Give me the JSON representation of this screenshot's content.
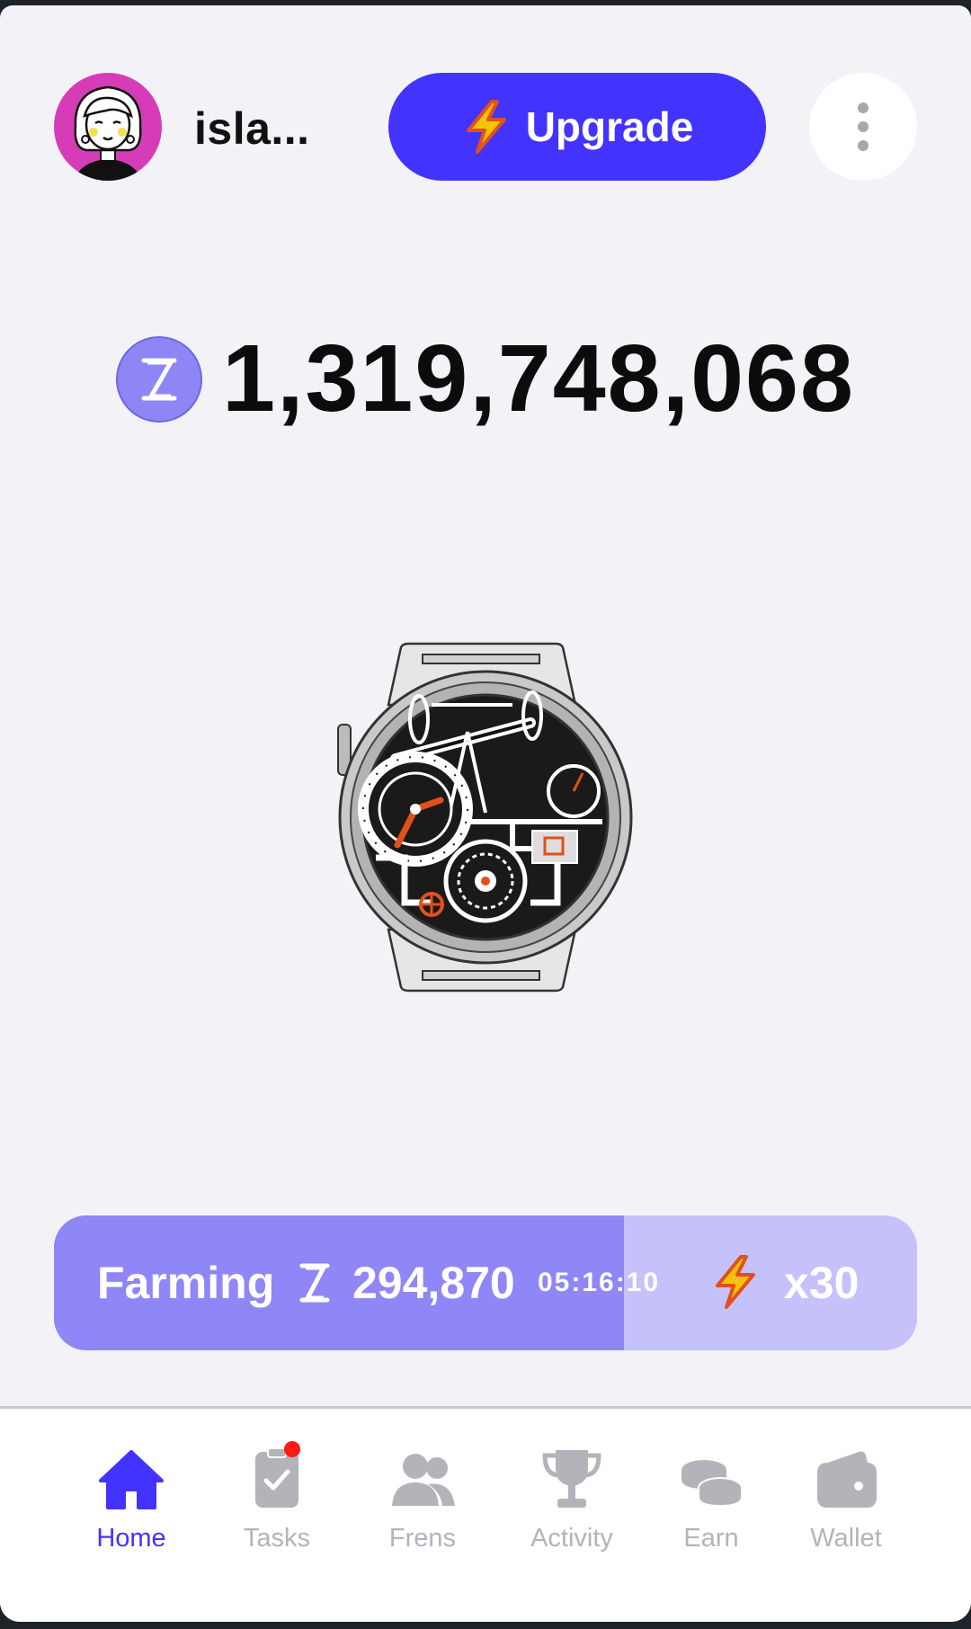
{
  "header": {
    "username": "isla...",
    "upgrade_label": "Upgrade"
  },
  "balance": {
    "value": "1,319,748,068"
  },
  "farming": {
    "label": "Farming",
    "amount": "294,870",
    "timer": "05:16:10",
    "multiplier": "x30",
    "progress": 0.66
  },
  "nav": {
    "items": [
      {
        "label": "Home",
        "icon": "home-icon",
        "active": true
      },
      {
        "label": "Tasks",
        "icon": "tasks-icon",
        "badge": true
      },
      {
        "label": "Frens",
        "icon": "friends-icon"
      },
      {
        "label": "Activity",
        "icon": "trophy-icon"
      },
      {
        "label": "Earn",
        "icon": "coins-icon"
      },
      {
        "label": "Wallet",
        "icon": "wallet-icon"
      }
    ]
  },
  "colors": {
    "accent": "#4333ff",
    "farm_fill": "#8f86f7",
    "farm_bg": "#c5c1fb",
    "inactive": "#b3b3ba",
    "avatar_bg": "#d63cb8"
  }
}
